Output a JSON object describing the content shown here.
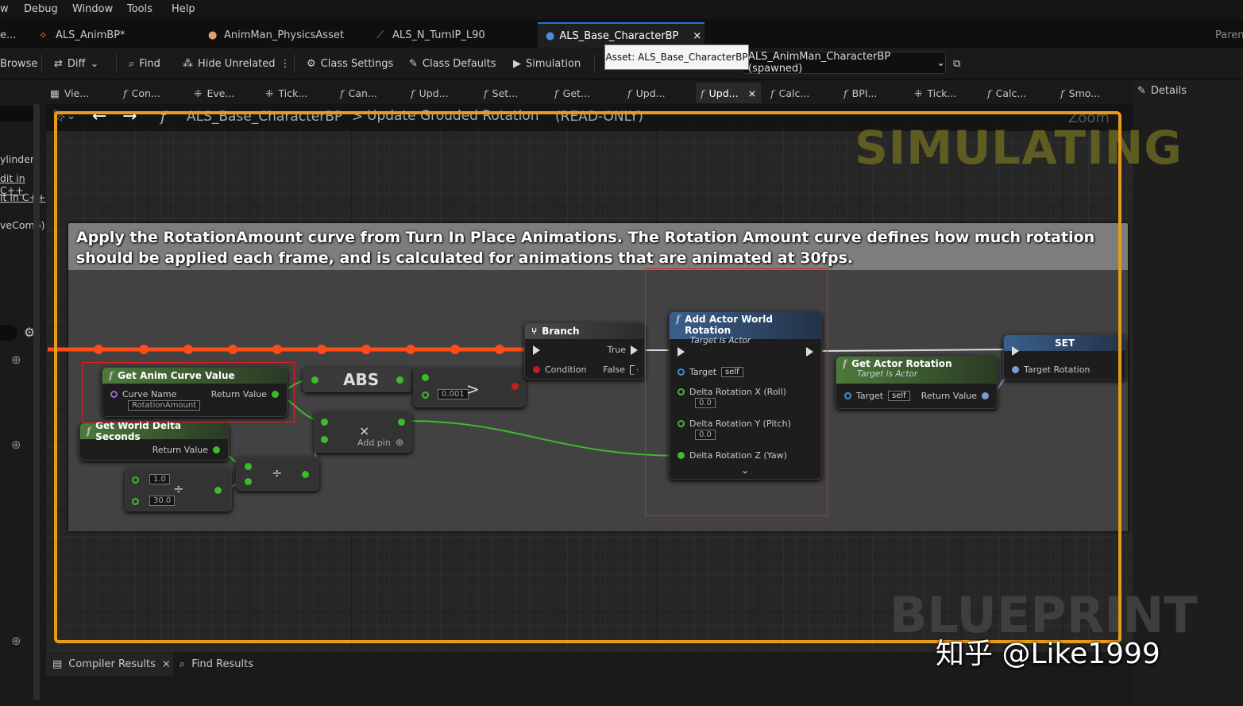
{
  "menu": [
    "w",
    "Debug",
    "Window",
    "Tools",
    "Help"
  ],
  "doc_tabs": [
    {
      "label": "e..."
    },
    {
      "label": "ALS_AnimBP*"
    },
    {
      "label": "AnimMan_PhysicsAsset"
    },
    {
      "label": "ALS_N_TurnIP_L90"
    },
    {
      "label": "ALS_Base_CharacterBP",
      "close": "×"
    },
    {
      "label": "Paren"
    }
  ],
  "toolbar": {
    "browse": "Browse",
    "diff": "Diff",
    "find": "Find",
    "hide_unrelated": "Hide Unrelated",
    "class_settings": "Class Settings",
    "class_defaults": "Class Defaults",
    "simulation": "Simulation",
    "debug_object": "ALS_AnimMan_CharacterBP (spawned)"
  },
  "tooltip": "Asset: ALS_Base_CharacterBP",
  "graph_tabs": [
    "Vie...",
    "Con...",
    "Eve...",
    "Tick...",
    "Can...",
    "Upd...",
    "Set...",
    "Get...",
    "Upd...",
    "Upd...",
    "Calc...",
    "BPI...",
    "Tick...",
    "Calc...",
    "Smo..."
  ],
  "graph_tab_close": "×",
  "details_title": "Details",
  "left_panel": {
    "items": [
      "ylinder)",
      "dit in C++",
      "it in C++",
      "veComp)"
    ]
  },
  "breadcrumb": {
    "bp": "ALS_Base_CharacterBP",
    "sep": ">",
    "function": "Update Grouded Rotation",
    "mode": "(READ-ONLY)",
    "zoom": "Zoom"
  },
  "watermarks": {
    "simulating": "SIMULATING",
    "blueprint": "BLUEPRINT",
    "credit": "知乎 @Like1999"
  },
  "comment": "Apply the RotationAmount curve from Turn In Place Animations. The Rotation Amount curve defines how much rotation should be applied each frame, and is calculated for animations that are animated at 30fps.",
  "nodes": {
    "get_anim_curve": {
      "title": "Get Anim Curve Value",
      "curve_name": "Curve Name",
      "curve_value": "RotationAmount",
      "return": "Return Value"
    },
    "world_delta": {
      "title": "Get World Delta Seconds",
      "return": "Return Value"
    },
    "abs": {
      "title": "ABS"
    },
    "greater": {
      "value": "0.001",
      "op": ">"
    },
    "multiply": {
      "op": "×",
      "add_pin": "Add pin"
    },
    "divide1": {
      "a": "1.0",
      "b": "30.0",
      "op": "÷"
    },
    "divide2": {
      "op": "÷"
    },
    "branch": {
      "title": "Branch",
      "true": "True",
      "false": "False",
      "condition": "Condition"
    },
    "add_actor_rot": {
      "title": "Add Actor World Rotation",
      "subtitle": "Target is Actor",
      "target": "Target",
      "self": "self",
      "rx": "Delta Rotation X (Roll)",
      "ry": "Delta Rotation Y (Pitch)",
      "rz": "Delta Rotation Z (Yaw)",
      "vx": "0.0",
      "vy": "0.0"
    },
    "get_actor_rot": {
      "title": "Get Actor Rotation",
      "subtitle": "Target is Actor",
      "target": "Target",
      "self": "self",
      "return": "Return Value"
    },
    "set": {
      "title": "SET",
      "target_rotation": "Target Rotation"
    }
  },
  "bottom_tabs": [
    {
      "label": "Compiler Results",
      "close": "×"
    },
    {
      "label": "Find Results"
    }
  ]
}
